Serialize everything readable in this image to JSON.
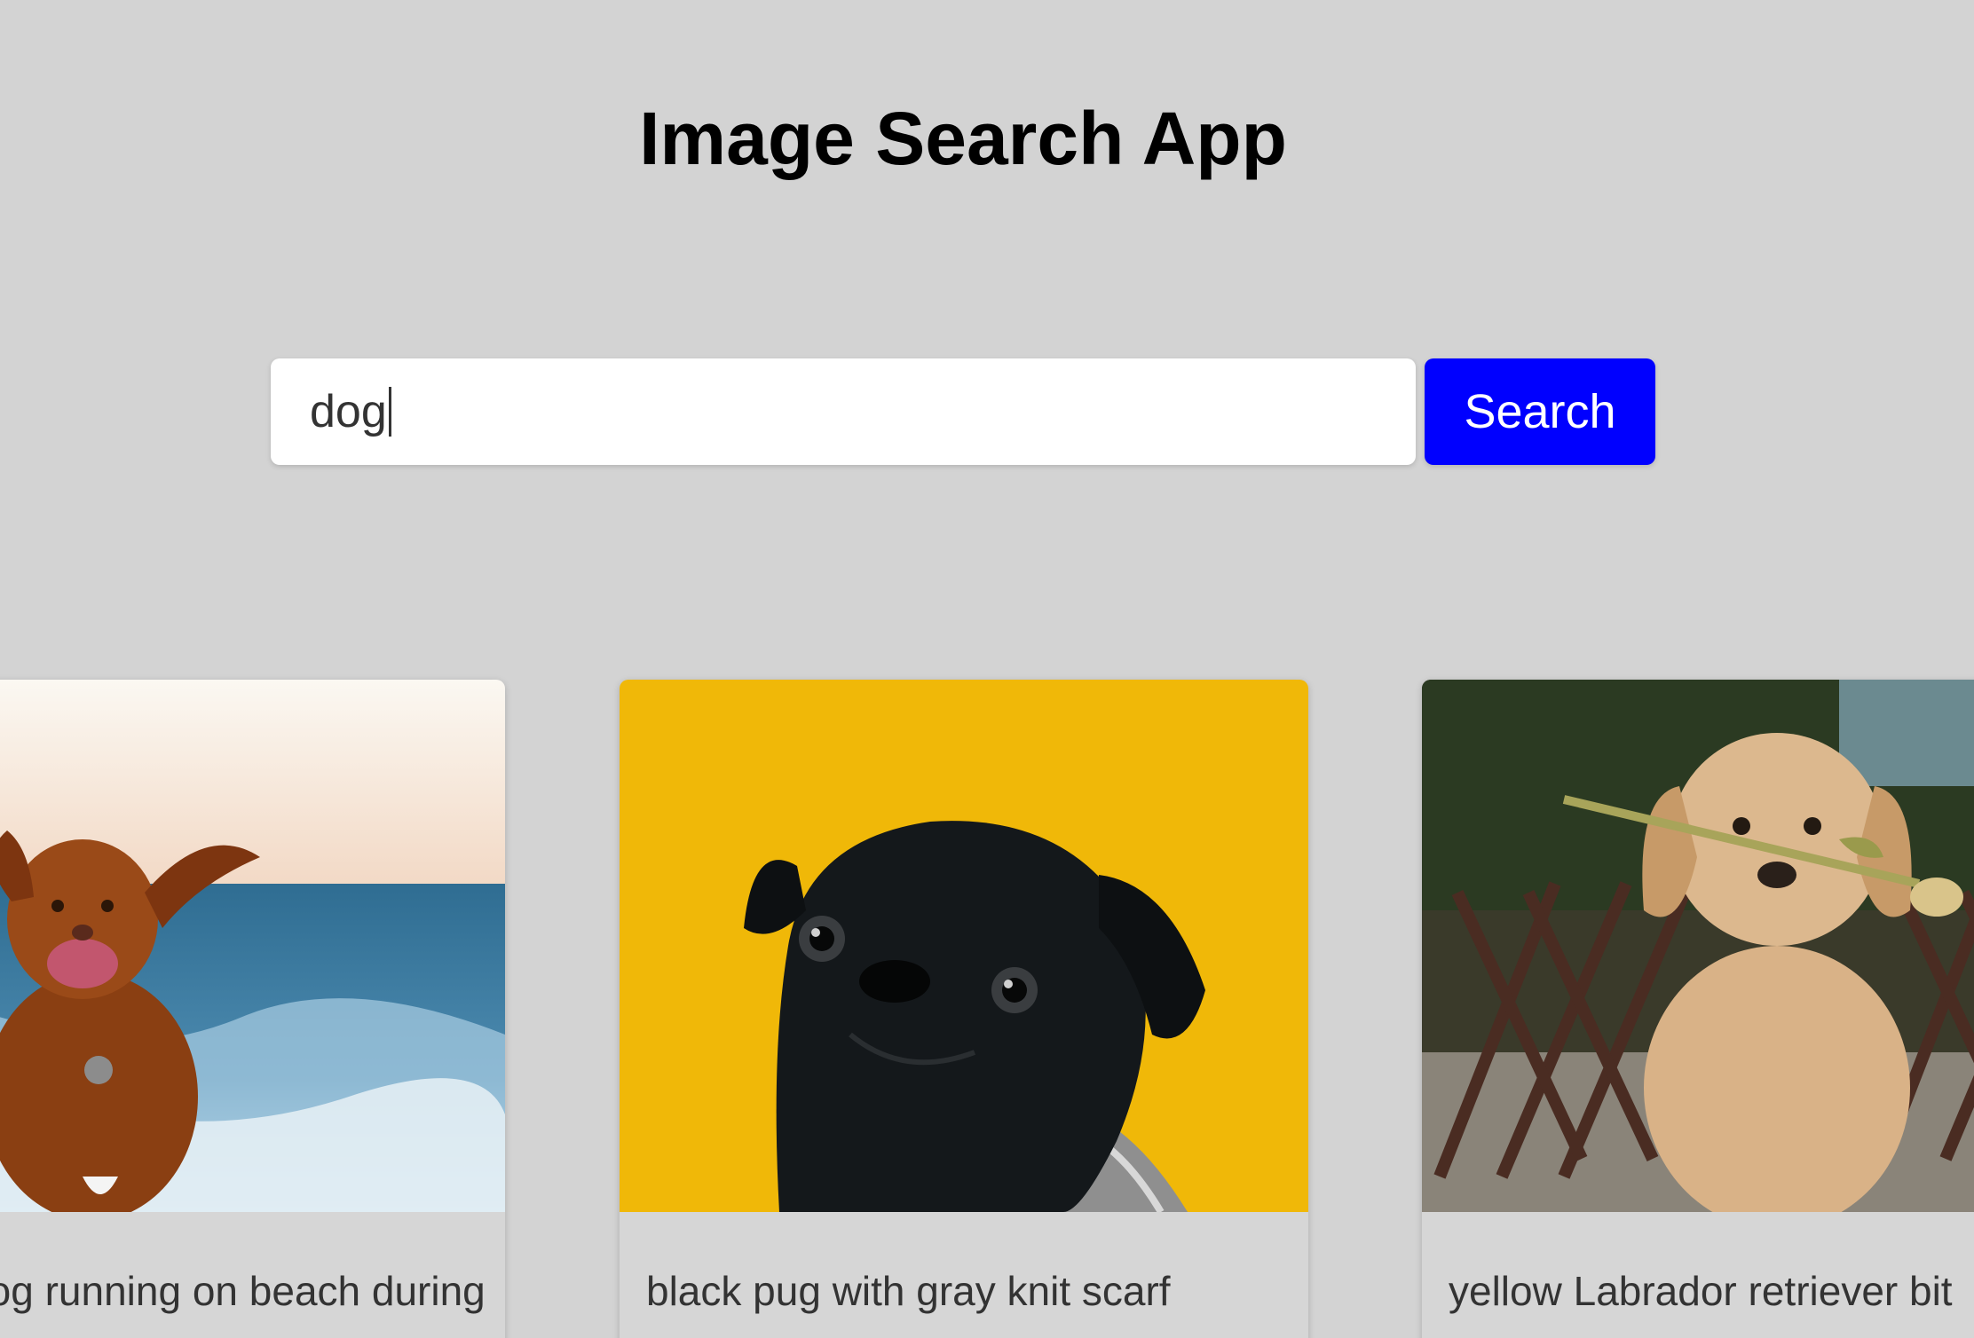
{
  "header": {
    "title": "Image Search App"
  },
  "search": {
    "value": "dog",
    "button_label": "Search"
  },
  "results": [
    {
      "caption": "brown dog running on beach during",
      "visible_caption": "ning on beach during",
      "image": "dog-on-beach"
    },
    {
      "caption": "black pug with gray knit scarf",
      "image": "black-pug-yellow-background"
    },
    {
      "caption": "yellow Labrador retriever bit",
      "image": "golden-puppy-with-flower"
    }
  ],
  "colors": {
    "background": "#d3d3d3",
    "button": "#0000ff",
    "pug_background": "#f0b808"
  }
}
